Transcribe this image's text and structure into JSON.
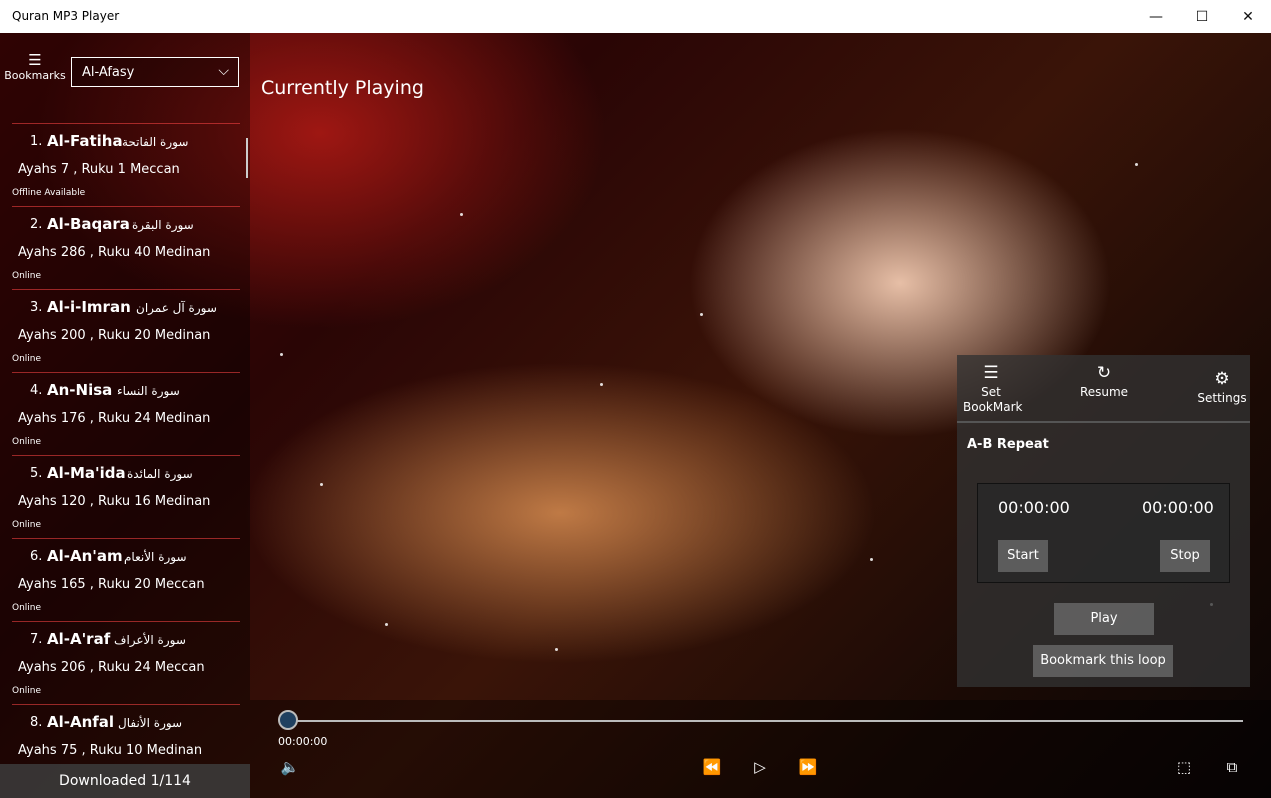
{
  "window": {
    "title": "Quran MP3 Player",
    "minimize": "—",
    "maximize": "☐",
    "close": "✕"
  },
  "sidebar": {
    "bookmarks_label": "Bookmarks",
    "reciter": "Al-Afasy",
    "surahs": [
      {
        "num": "1.",
        "en": "Al-Fatiha",
        "ar": "سورة الفاتحة",
        "info": "Ayahs 7 , Ruku 1 Meccan",
        "status": "Offline Available"
      },
      {
        "num": "2.",
        "en": "Al-Baqara",
        "ar": "سورة البقرة",
        "info": "Ayahs 286 , Ruku 40 Medinan",
        "status": "Online"
      },
      {
        "num": "3.",
        "en": "Al-i-Imran",
        "ar": "سورة آل عمران",
        "info": "Ayahs 200 , Ruku 20 Medinan",
        "status": "Online"
      },
      {
        "num": "4.",
        "en": "An-Nisa",
        "ar": "سورة النساء",
        "info": "Ayahs 176 , Ruku 24 Medinan",
        "status": "Online"
      },
      {
        "num": "5.",
        "en": "Al-Ma'ida",
        "ar": "سورة المائدة",
        "info": "Ayahs 120 , Ruku 16 Medinan",
        "status": "Online"
      },
      {
        "num": "6.",
        "en": "Al-An'am",
        "ar": "سورة الأنعام",
        "info": "Ayahs 165 , Ruku 20 Meccan",
        "status": "Online"
      },
      {
        "num": "7.",
        "en": "Al-A'raf",
        "ar": "سورة الأعراف",
        "info": "Ayahs 206 , Ruku 24 Meccan",
        "status": "Online"
      },
      {
        "num": "8.",
        "en": "Al-Anfal",
        "ar": "سورة الأنفال",
        "info": "Ayahs 75 , Ruku 10 Medinan",
        "status": ""
      }
    ],
    "downloaded": "Downloaded 1/114"
  },
  "main": {
    "title": "Currently Playing"
  },
  "panel": {
    "set_bookmark": "Set\nBookMark",
    "resume": "Resume",
    "settings": "Settings",
    "ab_repeat": "A-B Repeat",
    "time_a": "00:00:00",
    "time_b": "00:00:00",
    "start": "Start",
    "stop": "Stop",
    "play": "Play",
    "bookmark_loop": "Bookmark this loop"
  },
  "player": {
    "position": "00:00:00",
    "progress": 0
  }
}
